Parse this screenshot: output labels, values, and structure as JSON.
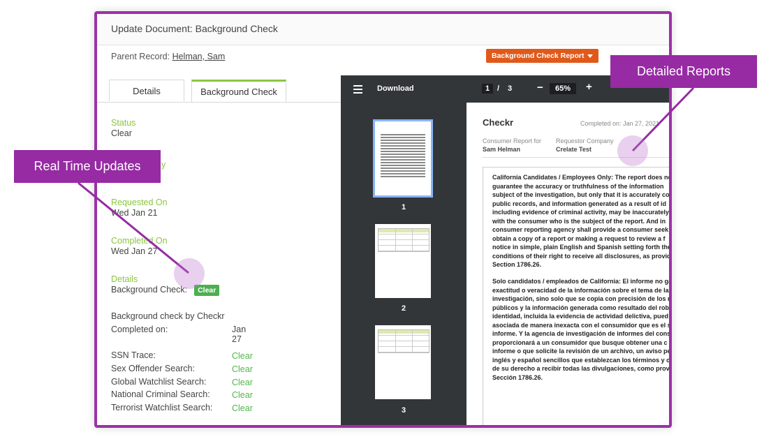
{
  "header": {
    "title": "Update Document: Background Check"
  },
  "parent_record": {
    "label": "Parent Record:",
    "link": "Helman, Sam"
  },
  "report_button": {
    "label": "Background Check Report"
  },
  "tabs": [
    {
      "label": "Details"
    },
    {
      "label": "Background Check"
    }
  ],
  "fields": {
    "status": {
      "label": "Status",
      "value": "Clear"
    },
    "partial_label_fragment": "y",
    "requested_on": {
      "label": "Requested On",
      "value": "Wed Jan 21"
    },
    "completed_on": {
      "label": "Completed On",
      "value": "Wed Jan 27"
    },
    "details": {
      "label": "Details",
      "value": "Background Check:",
      "badge": "Clear"
    }
  },
  "summary": {
    "by": "Background check by Checkr",
    "completed_label": "Completed on:",
    "completed_value": "Jan 27"
  },
  "checks": [
    {
      "name": "SSN Trace:",
      "result": "Clear"
    },
    {
      "name": "Sex Offender Search:",
      "result": "Clear"
    },
    {
      "name": "Global Watchlist Search:",
      "result": "Clear"
    },
    {
      "name": "National Criminal Search:",
      "result": "Clear"
    },
    {
      "name": "Terrorist Watchlist Search:",
      "result": "Clear"
    }
  ],
  "viewer": {
    "download_label": "Download",
    "page_current": "1",
    "page_sep": "/",
    "page_total": "3",
    "zoom_minus": "−",
    "zoom": "65%",
    "zoom_plus": "+",
    "thumbs": [
      {
        "num": "1"
      },
      {
        "num": "2"
      },
      {
        "num": "3"
      }
    ],
    "doc": {
      "vendor": "Checkr",
      "completed": "Completed on: Jan 27, 2021",
      "consumer_label": "Consumer Report for",
      "consumer_value": "Sam Helman",
      "company_label": "Requestor Company",
      "company_value": "Crelate Test",
      "para_en": "California Candidates / Employees Only: The report does no\nguarantee the accuracy or truthfulness of the information\nsubject of the investigation, but only that it is accurately co\npublic records, and information generated as a result of id\nincluding evidence of criminal activity, may be inaccurately\nwith the consumer who is the subject of the report. And in\nconsumer reporting agency shall provide a consumer seek\nobtain a copy of a report or making a request to review a f\nnotice in simple, plain English and Spanish setting forth the\nconditions of their right to receive all disclosures, as provid\nSection 1786.26.",
      "para_es": "Solo candidatos / empleados de California: El informe no ga\nexactitud o veracidad de la información sobre el tema de la\ninvestigación, sino solo que se copia con precisión de los re\npúblicos y la información generada como resultado del rob\nidentidad, incluida la evidencia de actividad delictiva, pued\nasociada de manera inexacta con el consumidor que es el s\ninforme. Y la agencia de investigación de informes del cons\nproporcionará a un consumidor que busque obtener una c\ninforme o que solicite la revisión de un archivo, un aviso pe\ninglés y español sencillos que establezcan los términos y c\nde su derecho a recibir todas las divulgaciones, como prov\nSección 1786.26."
    }
  },
  "callouts": {
    "realtime": "Real Time Updates",
    "detailed": "Detailed Reports"
  },
  "colors": {
    "accent_purple": "#962ba3",
    "green_label": "#8cc540",
    "orange_button": "#e0591b",
    "clear_green": "#52b64a"
  }
}
